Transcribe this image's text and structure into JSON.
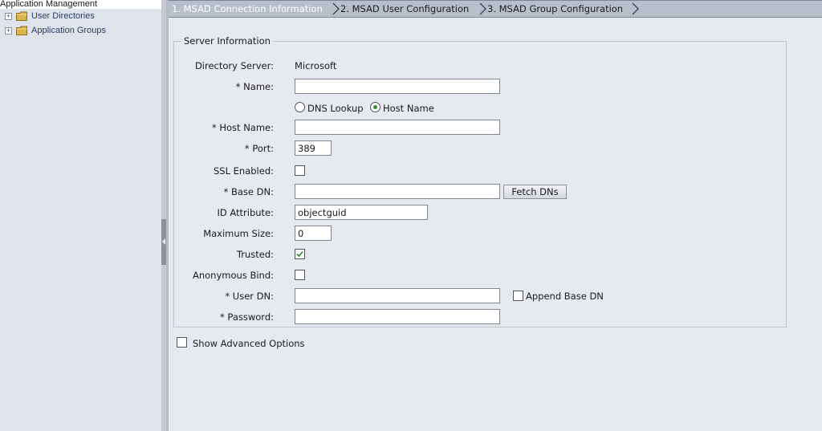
{
  "tree": {
    "root_label": "Application Management",
    "items": [
      {
        "label": "User Directories",
        "expander": "+",
        "icon": "folder-icon"
      },
      {
        "label": "Application Groups",
        "expander": "+",
        "icon": "folder-icon"
      }
    ]
  },
  "wizard": {
    "steps": [
      {
        "label": "1. MSAD Connection Information",
        "state": "active"
      },
      {
        "label": "2. MSAD User Configuration",
        "state": "inactive"
      },
      {
        "label": "3. MSAD Group Configuration",
        "state": "inactive"
      }
    ]
  },
  "form": {
    "section_title": "Server Information",
    "directory_server": {
      "label": "Directory Server:",
      "value": "Microsoft"
    },
    "name": {
      "label": "* Name:",
      "value": ""
    },
    "lookup_mode": {
      "options": [
        "DNS Lookup",
        "Host Name"
      ],
      "selected": "Host Name"
    },
    "host_name": {
      "label": "* Host Name:",
      "value": ""
    },
    "port": {
      "label": "* Port:",
      "value": "389"
    },
    "ssl_enabled": {
      "label": "SSL Enabled:",
      "checked": false
    },
    "base_dn": {
      "label": "* Base DN:",
      "value": "",
      "button": "Fetch DNs"
    },
    "id_attribute": {
      "label": "ID Attribute:",
      "value": "objectguid"
    },
    "maximum_size": {
      "label": "Maximum Size:",
      "value": "0"
    },
    "trusted": {
      "label": "Trusted:",
      "checked": true
    },
    "anonymous_bind": {
      "label": "Anonymous Bind:",
      "checked": false
    },
    "user_dn": {
      "label": "* User DN:",
      "value": "",
      "append_base_dn_label": "Append Base DN",
      "append_base_dn_checked": false
    },
    "password": {
      "label": "* Password:",
      "value": ""
    },
    "show_advanced": {
      "label": "Show Advanced Options",
      "checked": false
    }
  },
  "colors": {
    "radio_selected": "#2e8b2e",
    "check_mark": "#2e8b2e",
    "active_step_text": "#ffffff"
  }
}
